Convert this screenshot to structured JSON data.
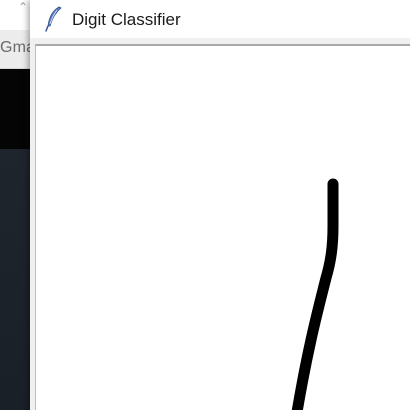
{
  "background_window": {
    "tab_label": "Gma"
  },
  "app": {
    "title": "Digit Classifier",
    "icon": "feather-icon"
  },
  "canvas": {
    "background": "#ffffff",
    "stroke_color": "#000000",
    "content": "hand-drawn digit stroke"
  }
}
